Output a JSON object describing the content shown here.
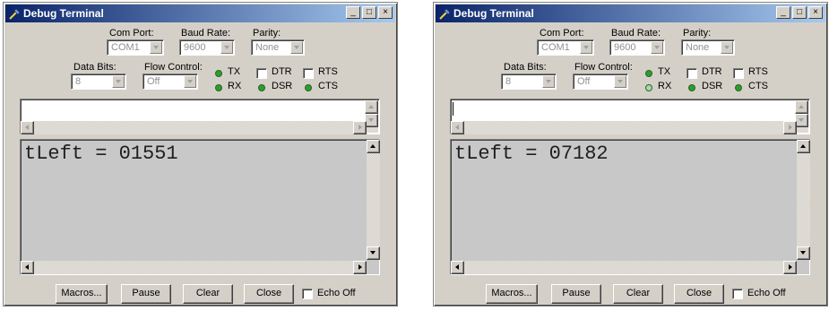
{
  "windows": [
    {
      "title": "Debug Terminal",
      "title_buttons": {
        "minimize": "_",
        "maximize": "□",
        "close": "×"
      },
      "com_port": {
        "label": "Com Port:",
        "value": "COM1"
      },
      "baud_rate": {
        "label": "Baud Rate:",
        "value": "9600"
      },
      "parity": {
        "label": "Parity:",
        "value": "None"
      },
      "data_bits": {
        "label": "Data Bits:",
        "value": "8"
      },
      "flow_control": {
        "label": "Flow Control:",
        "value": "Off"
      },
      "indicators": {
        "tx": {
          "label": "TX",
          "state": "on"
        },
        "rx": {
          "label": "RX",
          "state": "on"
        },
        "dsr": {
          "label": "DSR",
          "state": "on"
        },
        "cts": {
          "label": "CTS",
          "state": "on"
        }
      },
      "dtr_label": "DTR",
      "rts_label": "RTS",
      "receive_text": "tLeft = 01551",
      "buttons": {
        "macros": "Macros...",
        "pause": "Pause",
        "clear": "Clear",
        "close": "Close"
      },
      "echo_off_label": "Echo Off"
    },
    {
      "title": "Debug Terminal",
      "title_buttons": {
        "minimize": "_",
        "maximize": "□",
        "close": "×"
      },
      "com_port": {
        "label": "Com Port:",
        "value": "COM1"
      },
      "baud_rate": {
        "label": "Baud Rate:",
        "value": "9600"
      },
      "parity": {
        "label": "Parity:",
        "value": "None"
      },
      "data_bits": {
        "label": "Data Bits:",
        "value": "8"
      },
      "flow_control": {
        "label": "Flow Control:",
        "value": "Off"
      },
      "indicators": {
        "tx": {
          "label": "TX",
          "state": "on"
        },
        "rx": {
          "label": "RX",
          "state": "off"
        },
        "dsr": {
          "label": "DSR",
          "state": "on"
        },
        "cts": {
          "label": "CTS",
          "state": "on"
        }
      },
      "dtr_label": "DTR",
      "rts_label": "RTS",
      "receive_text": "tLeft = 07182",
      "buttons": {
        "macros": "Macros...",
        "pause": "Pause",
        "clear": "Clear",
        "close": "Close"
      },
      "echo_off_label": "Echo Off"
    }
  ],
  "colors": {
    "titlebar_start": "#0a246a",
    "titlebar_end": "#a6caf0",
    "window_face": "#d4d0c8",
    "led_on": "#28a028",
    "led_off": "#a8d8a8",
    "receive_bg": "#c8c8c8"
  },
  "icons": {
    "app": "debug-terminal-icon"
  }
}
